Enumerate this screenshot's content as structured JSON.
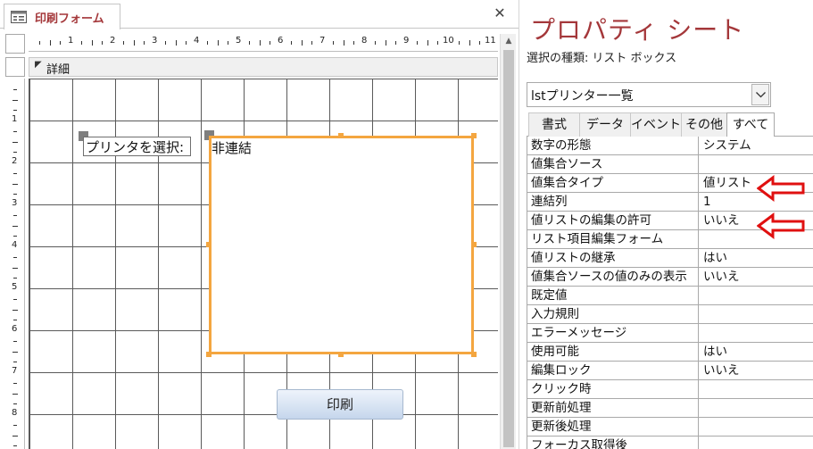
{
  "document": {
    "tab_label": "印刷フォーム",
    "close_glyph": "✕",
    "section_label": "詳細"
  },
  "ruler": {
    "h_numbers": [
      "1",
      "2",
      "3",
      "4",
      "5",
      "6",
      "7",
      "8",
      "9",
      "10",
      "11"
    ],
    "v_numbers": [
      "1",
      "2",
      "3",
      "4",
      "5",
      "6",
      "7",
      "8"
    ]
  },
  "form": {
    "label_text": "プリンタを選択:",
    "listbox_text": "非連結",
    "print_button": "印刷"
  },
  "property_sheet": {
    "title": "プロパティ シート",
    "selection_type_label": "選択の種類:",
    "selection_type_value": "リスト ボックス",
    "selected_control": "lstプリンター一覧",
    "tabs": [
      "書式",
      "データ",
      "イベント",
      "その他",
      "すべて"
    ],
    "active_tab": "すべて",
    "rows": [
      {
        "name": "数字の形態",
        "value": "システム"
      },
      {
        "name": "値集合ソース",
        "value": ""
      },
      {
        "name": "値集合タイプ",
        "value": "値リスト"
      },
      {
        "name": "連結列",
        "value": "1"
      },
      {
        "name": "値リストの編集の許可",
        "value": "いいえ"
      },
      {
        "name": "リスト項目編集フォーム",
        "value": ""
      },
      {
        "name": "値リストの継承",
        "value": "はい"
      },
      {
        "name": "値集合ソースの値のみの表示",
        "value": "いいえ"
      },
      {
        "name": "既定値",
        "value": ""
      },
      {
        "name": "入力規則",
        "value": ""
      },
      {
        "name": "エラーメッセージ",
        "value": ""
      },
      {
        "name": "使用可能",
        "value": "はい"
      },
      {
        "name": "編集ロック",
        "value": "いいえ"
      },
      {
        "name": "クリック時",
        "value": ""
      },
      {
        "name": "更新前処理",
        "value": ""
      },
      {
        "name": "更新後処理",
        "value": ""
      },
      {
        "name": "フォーカス取得後",
        "value": ""
      }
    ]
  },
  "colors": {
    "title_red": "#a4373a",
    "selection_orange": "#f4a640",
    "annotation_red": "#e01010"
  }
}
